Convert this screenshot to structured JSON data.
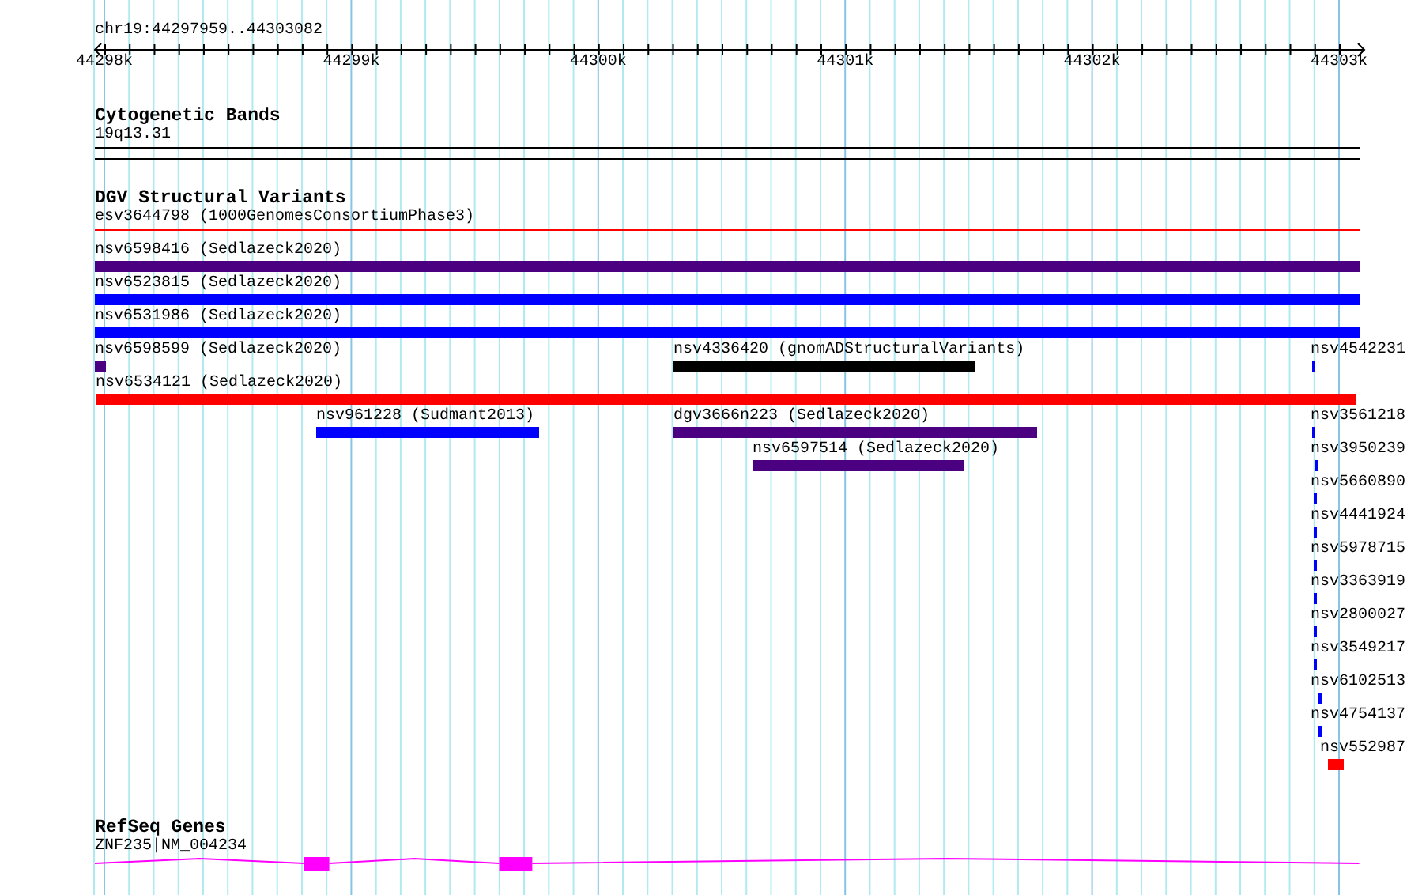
{
  "location": "chr19:44297959..44303082",
  "ruler": {
    "ticks": [
      "44298k",
      "44299k",
      "44300k",
      "44301k",
      "44302k",
      "44303k"
    ]
  },
  "tracks": [
    {
      "kind": "bands",
      "title": "Cytogenetic Bands",
      "features": [
        {
          "label": "19q13.31"
        }
      ]
    },
    {
      "kind": "variants",
      "title": "DGV Structural Variants",
      "lanes": [
        {
          "features": [
            {
              "kind": "thin",
              "label": "esv3644798 (1000GenomesConsortiumPhase3)",
              "color": "#ff0000"
            }
          ]
        },
        {
          "features": [
            {
              "kind": "bar",
              "label": "nsv6598416 (Sedlazeck2020)",
              "color": "#4b0082"
            }
          ]
        },
        {
          "features": [
            {
              "kind": "bar",
              "label": "nsv6523815 (Sedlazeck2020)",
              "color": "#0000ff"
            }
          ]
        },
        {
          "features": [
            {
              "kind": "bar",
              "label": "nsv6531986 (Sedlazeck2020)",
              "color": "#0000ff"
            }
          ]
        },
        {
          "features": [
            {
              "kind": "bar",
              "label": "nsv6598599 (Sedlazeck2020)",
              "color": "#4b0082"
            },
            {
              "kind": "bar",
              "label": "nsv4336420 (gnomADStructuralVariants)",
              "color": "#000000"
            },
            {
              "kind": "bar",
              "label": "nsv4542231",
              "color": "#0000ff"
            }
          ]
        },
        {
          "features": [
            {
              "kind": "bar",
              "label": "nsv6534121 (Sedlazeck2020)",
              "color": "#ff0000"
            }
          ]
        },
        {
          "features": [
            {
              "kind": "bar",
              "label": "nsv961228 (Sudmant2013)",
              "color": "#0000ff"
            },
            {
              "kind": "bar",
              "label": "dgv3666n223 (Sedlazeck2020)",
              "color": "#4b0082"
            },
            {
              "kind": "bar",
              "label": "nsv3561218",
              "color": "#0000ff"
            }
          ]
        },
        {
          "features": [
            {
              "kind": "bar",
              "label": "nsv6597514 (Sedlazeck2020)",
              "color": "#4b0082"
            },
            {
              "kind": "bar",
              "label": "nsv3950239",
              "color": "#0000ff"
            }
          ]
        },
        {
          "features": [
            {
              "kind": "bar",
              "label": "nsv5660890",
              "color": "#0000ff"
            }
          ]
        },
        {
          "features": [
            {
              "kind": "bar",
              "label": "nsv4441924",
              "color": "#0000ff"
            }
          ]
        },
        {
          "features": [
            {
              "kind": "bar",
              "label": "nsv5978715",
              "color": "#0000ff"
            }
          ]
        },
        {
          "features": [
            {
              "kind": "bar",
              "label": "nsv3363919",
              "color": "#0000ff"
            }
          ]
        },
        {
          "features": [
            {
              "kind": "bar",
              "label": "nsv2800027",
              "color": "#0000ff"
            }
          ]
        },
        {
          "features": [
            {
              "kind": "bar",
              "label": "nsv3549217",
              "color": "#0000ff"
            }
          ]
        },
        {
          "features": [
            {
              "kind": "bar",
              "label": "nsv6102513",
              "color": "#0000ff"
            }
          ]
        },
        {
          "features": [
            {
              "kind": "bar",
              "label": "nsv4754137",
              "color": "#0000ff"
            }
          ]
        },
        {
          "features": [
            {
              "kind": "bar",
              "label": "nsv552987",
              "color": "#ff0000"
            }
          ]
        }
      ]
    },
    {
      "kind": "genes",
      "title": "RefSeq Genes",
      "features": [
        {
          "label": "ZNF235|NM_004234"
        }
      ]
    }
  ]
}
